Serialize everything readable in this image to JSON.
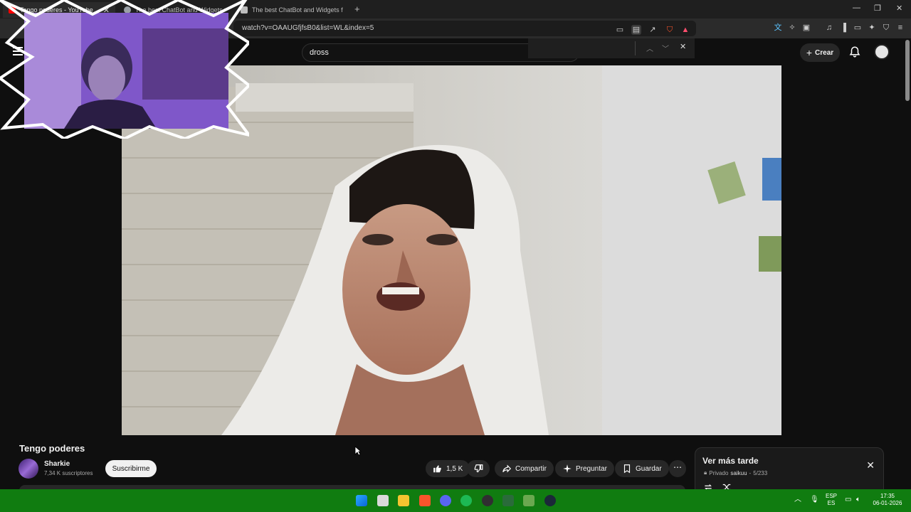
{
  "browser": {
    "tabs": [
      {
        "title": "Tengo poderes - YouTube",
        "active": true
      },
      {
        "title": "The best ChatBot and Widgets for Kick"
      },
      {
        "title": "The best ChatBot and Widgets for Ki"
      }
    ],
    "new_tab": "+",
    "url": "watch?v=OAAUGfjfsB0&list=WL&index=5",
    "window_controls": {
      "minimize": "—",
      "maximize": "❐",
      "close": "✕"
    }
  },
  "header": {
    "search_value": "dross",
    "create_label": "Crear"
  },
  "video": {
    "title": "Tengo poderes",
    "channel": "Sharkie",
    "subscribers": "7,34 K suscriptores",
    "subscribe_label": "Suscribirme",
    "likes": "1,5 K",
    "share_label": "Compartir",
    "ask_label": "Preguntar",
    "save_label": "Guardar"
  },
  "playlist": {
    "title": "Ver más tarde",
    "privacy": "Privado",
    "owner": "saikuu",
    "position": "5/233"
  },
  "taskbar": {
    "lang": "ESP",
    "lang_sub": "ES",
    "time": "17:35",
    "date": "06-01-2026"
  },
  "colors": {
    "taskbar": "#107c10",
    "background": "#0f0f0f",
    "accent_purple": "#8a5fd0"
  }
}
